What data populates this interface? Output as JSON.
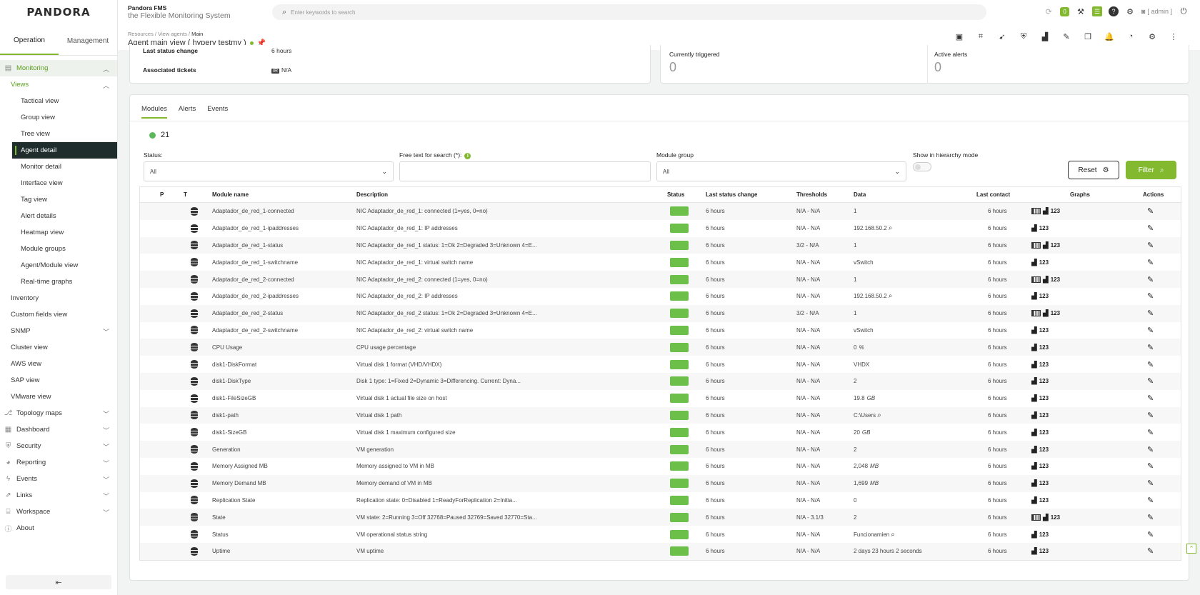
{
  "logo": "PANDORA",
  "sidebar": {
    "tabs": [
      "Operation",
      "Management"
    ],
    "items": [
      {
        "label": "Monitoring",
        "kind": "top",
        "icon": "monitor-icon",
        "green": true,
        "chev": "up"
      },
      {
        "label": "Views",
        "kind": "sub0",
        "green": true,
        "chev": "up"
      },
      {
        "label": "Tactical view",
        "kind": "sub"
      },
      {
        "label": "Group view",
        "kind": "sub"
      },
      {
        "label": "Tree view",
        "kind": "sub"
      },
      {
        "label": "Agent detail",
        "kind": "sub",
        "active": true
      },
      {
        "label": "Monitor detail",
        "kind": "sub"
      },
      {
        "label": "Interface view",
        "kind": "sub"
      },
      {
        "label": "Tag view",
        "kind": "sub"
      },
      {
        "label": "Alert details",
        "kind": "sub"
      },
      {
        "label": "Heatmap view",
        "kind": "sub"
      },
      {
        "label": "Module groups",
        "kind": "sub"
      },
      {
        "label": "Agent/Module view",
        "kind": "sub"
      },
      {
        "label": "Real-time graphs",
        "kind": "sub"
      },
      {
        "label": "Inventory",
        "kind": "sub0"
      },
      {
        "label": "Custom fields view",
        "kind": "sub0"
      },
      {
        "label": "SNMP",
        "kind": "sub0",
        "chev": "down"
      },
      {
        "label": "Cluster view",
        "kind": "sub0"
      },
      {
        "label": "AWS view",
        "kind": "sub0"
      },
      {
        "label": "SAP view",
        "kind": "sub0"
      },
      {
        "label": "VMware view",
        "kind": "sub0"
      },
      {
        "label": "Topology maps",
        "kind": "top",
        "icon": "topology-icon",
        "chev": "down"
      },
      {
        "label": "Dashboard",
        "kind": "top",
        "icon": "dashboard-icon",
        "chev": "down"
      },
      {
        "label": "Security",
        "kind": "top",
        "icon": "shield-icon",
        "chev": "down"
      },
      {
        "label": "Reporting",
        "kind": "top",
        "icon": "pie-chart-icon",
        "chev": "down"
      },
      {
        "label": "Events",
        "kind": "top",
        "icon": "bolt-icon",
        "chev": "down"
      },
      {
        "label": "Links",
        "kind": "top",
        "icon": "link-icon",
        "chev": "down"
      },
      {
        "label": "Workspace",
        "kind": "top",
        "icon": "workspace-icon",
        "chev": "down"
      },
      {
        "label": "About",
        "kind": "top",
        "icon": "info-icon"
      }
    ]
  },
  "header": {
    "product": "Pandora FMS",
    "tagline": "the Flexible Monitoring System",
    "search_placeholder": "Enter keywords to search",
    "notif_count": "0",
    "user": "[ admin ]"
  },
  "breadcrumb": {
    "path": "Resources / View agents / ",
    "current": "Main"
  },
  "page_title": "Agent main view ( hyperv testmv )",
  "info": {
    "last_status_label": "Last status change",
    "last_status_value": "6 hours",
    "tickets_label": "Associated tickets",
    "tickets_value": "N/A",
    "triggered_label": "Currently triggered",
    "triggered_value": "0",
    "active_label": "Active alerts",
    "active_value": "0"
  },
  "panel": {
    "tabs": [
      "Modules",
      "Alerts",
      "Events"
    ],
    "count": "21",
    "filters": {
      "status_label": "Status:",
      "status_value": "All",
      "free_text_label": "Free text for search (*):",
      "group_label": "Module group",
      "group_value": "All",
      "hierarchy_label": "Show in hierarchy mode",
      "reset": "Reset",
      "filter": "Filter"
    },
    "columns": [
      "P",
      "T",
      "Module name",
      "Description",
      "Status",
      "Last status change",
      "Thresholds",
      "Data",
      "Last contact",
      "Graphs",
      "Actions"
    ],
    "rows": [
      {
        "name": "Adaptador_de_red_1-connected",
        "desc": "NIC Adaptador_de_red_1: connected (1=yes, 0=no)",
        "lsc": "6 hours",
        "thr": "N/A - N/A",
        "data": "1",
        "unit": "",
        "mag": false,
        "contact": "6 hours",
        "bar": true
      },
      {
        "name": "Adaptador_de_red_1-ipaddresses",
        "desc": "NIC Adaptador_de_red_1: IP addresses",
        "lsc": "6 hours",
        "thr": "N/A - N/A",
        "data": "192.168.50.2",
        "unit": "",
        "mag": true,
        "contact": "6 hours",
        "bar": false
      },
      {
        "name": "Adaptador_de_red_1-status",
        "desc": "NIC Adaptador_de_red_1 status: 1=Ok 2=Degraded 3=Unknown 4=E...",
        "lsc": "6 hours",
        "thr": "3/2 - N/A",
        "data": "1",
        "unit": "",
        "mag": false,
        "contact": "6 hours",
        "bar": true
      },
      {
        "name": "Adaptador_de_red_1-switchname",
        "desc": "NIC Adaptador_de_red_1: virtual switch name",
        "lsc": "6 hours",
        "thr": "N/A - N/A",
        "data": "vSwitch",
        "unit": "",
        "mag": false,
        "contact": "6 hours",
        "bar": false
      },
      {
        "name": "Adaptador_de_red_2-connected",
        "desc": "NIC Adaptador_de_red_2: connected (1=yes, 0=no)",
        "lsc": "6 hours",
        "thr": "N/A - N/A",
        "data": "1",
        "unit": "",
        "mag": false,
        "contact": "6 hours",
        "bar": true
      },
      {
        "name": "Adaptador_de_red_2-ipaddresses",
        "desc": "NIC Adaptador_de_red_2: IP addresses",
        "lsc": "6 hours",
        "thr": "N/A - N/A",
        "data": "192.168.50.2",
        "unit": "",
        "mag": true,
        "contact": "6 hours",
        "bar": false
      },
      {
        "name": "Adaptador_de_red_2-status",
        "desc": "NIC Adaptador_de_red_2 status: 1=Ok 2=Degraded 3=Unknown 4=E...",
        "lsc": "6 hours",
        "thr": "3/2 - N/A",
        "data": "1",
        "unit": "",
        "mag": false,
        "contact": "6 hours",
        "bar": true
      },
      {
        "name": "Adaptador_de_red_2-switchname",
        "desc": "NIC Adaptador_de_red_2: virtual switch name",
        "lsc": "6 hours",
        "thr": "N/A - N/A",
        "data": "vSwitch",
        "unit": "",
        "mag": false,
        "contact": "6 hours",
        "bar": false
      },
      {
        "name": "CPU Usage",
        "desc": "CPU usage percentage",
        "lsc": "6 hours",
        "thr": "N/A - N/A",
        "data": "0",
        "unit": "%",
        "mag": false,
        "contact": "6 hours",
        "bar": false
      },
      {
        "name": "disk1-DiskFormat",
        "desc": "Virtual disk 1 format (VHD/VHDX)",
        "lsc": "6 hours",
        "thr": "N/A - N/A",
        "data": "VHDX",
        "unit": "",
        "mag": false,
        "contact": "6 hours",
        "bar": false
      },
      {
        "name": "disk1-DiskType",
        "desc": "Disk 1 type: 1=Fixed 2=Dynamic 3=Differencing. Current: Dyna...",
        "lsc": "6 hours",
        "thr": "N/A - N/A",
        "data": "2",
        "unit": "",
        "mag": false,
        "contact": "6 hours",
        "bar": false
      },
      {
        "name": "disk1-FileSizeGB",
        "desc": "Virtual disk 1 actual file size on host",
        "lsc": "6 hours",
        "thr": "N/A - N/A",
        "data": "19.8",
        "unit": "GB",
        "mag": false,
        "contact": "6 hours",
        "bar": false
      },
      {
        "name": "disk1-path",
        "desc": "Virtual disk 1 path",
        "lsc": "6 hours",
        "thr": "N/A - N/A",
        "data": "C:\\Users",
        "unit": "",
        "mag": true,
        "contact": "6 hours",
        "bar": false
      },
      {
        "name": "disk1-SizeGB",
        "desc": "Virtual disk 1 maximum configured size",
        "lsc": "6 hours",
        "thr": "N/A - N/A",
        "data": "20",
        "unit": "GB",
        "mag": false,
        "contact": "6 hours",
        "bar": false
      },
      {
        "name": "Generation",
        "desc": "VM generation",
        "lsc": "6 hours",
        "thr": "N/A - N/A",
        "data": "2",
        "unit": "",
        "mag": false,
        "contact": "6 hours",
        "bar": false
      },
      {
        "name": "Memory Assigned MB",
        "desc": "Memory assigned to VM in MB",
        "lsc": "6 hours",
        "thr": "N/A - N/A",
        "data": "2,048",
        "unit": "MB",
        "mag": false,
        "contact": "6 hours",
        "bar": false
      },
      {
        "name": "Memory Demand MB",
        "desc": "Memory demand of VM in MB",
        "lsc": "6 hours",
        "thr": "N/A - N/A",
        "data": "1,699",
        "unit": "MB",
        "mag": false,
        "contact": "6 hours",
        "bar": false
      },
      {
        "name": "Replication State",
        "desc": "Replication state: 0=Disabled 1=ReadyForReplication 2=Initia...",
        "lsc": "6 hours",
        "thr": "N/A - N/A",
        "data": "0",
        "unit": "",
        "mag": false,
        "contact": "6 hours",
        "bar": false
      },
      {
        "name": "State",
        "desc": "VM state: 2=Running 3=Off 32768=Paused 32769=Saved 32770=Sta...",
        "lsc": "6 hours",
        "thr": "N/A - 3.1/3",
        "data": "2",
        "unit": "",
        "mag": false,
        "contact": "6 hours",
        "bar": true
      },
      {
        "name": "Status",
        "desc": "VM operational status string",
        "lsc": "6 hours",
        "thr": "N/A - N/A",
        "data": "Funcionamien",
        "unit": "",
        "mag": true,
        "contact": "6 hours",
        "bar": false
      },
      {
        "name": "Uptime",
        "desc": "VM uptime",
        "lsc": "6 hours",
        "thr": "N/A - N/A",
        "data": "2 days 23 hours 2 seconds",
        "unit": "",
        "mag": false,
        "contact": "6 hours",
        "bar": false
      }
    ],
    "graph_num": "123"
  }
}
